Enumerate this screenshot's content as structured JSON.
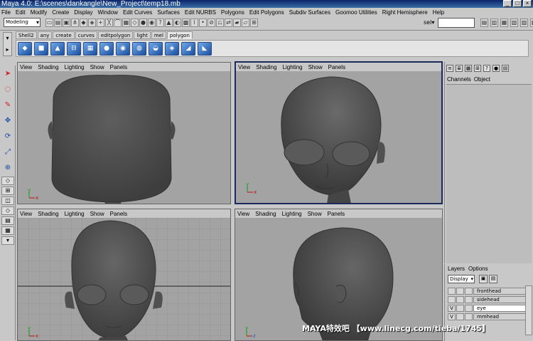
{
  "window": {
    "title": "Maya 4.0: E:\\scenes\\dankangle\\New_Project\\temp18.mb",
    "min": "_",
    "max": "□",
    "close": "×"
  },
  "menu": [
    "File",
    "Edit",
    "Modify",
    "Create",
    "Display",
    "Window",
    "Edit Curves",
    "Surfaces",
    "Edit NURBS",
    "Polygons",
    "Edit Polygons",
    "Subdiv Surfaces",
    "Goomoo Utilities",
    "Right Hemisphere",
    "Help"
  ],
  "status": {
    "mode": "Modeling",
    "sel_label": "sel▾",
    "sel_value": ""
  },
  "shelf": {
    "tabs": [
      "Shell2",
      "any",
      "create",
      "curves",
      "editpolygon",
      "light",
      "mel",
      "polygon"
    ],
    "active": "polygon"
  },
  "viewport_menu": [
    "View",
    "Shading",
    "Lighting",
    "Show",
    "Panels"
  ],
  "channel_box": {
    "menu": [
      "Channels",
      "Object"
    ]
  },
  "layers": {
    "menu": [
      "Layers",
      "Options"
    ],
    "display": "Display",
    "rows": [
      {
        "v": "",
        "name": "fronthead"
      },
      {
        "v": "",
        "name": "sidehead"
      },
      {
        "v": "V",
        "name": "eye"
      },
      {
        "v": "V",
        "name": "mmhead"
      }
    ]
  },
  "watermark": "MAYA特效吧 【www.linecg.com/tieba/1745】",
  "axis": {
    "x": "x",
    "y": "y",
    "z": "z"
  },
  "colors": {
    "viewport": "#a3a3a3",
    "mesh": "#4b4b4b",
    "title": "#0a246a",
    "active_border": "#1d2b5c"
  }
}
